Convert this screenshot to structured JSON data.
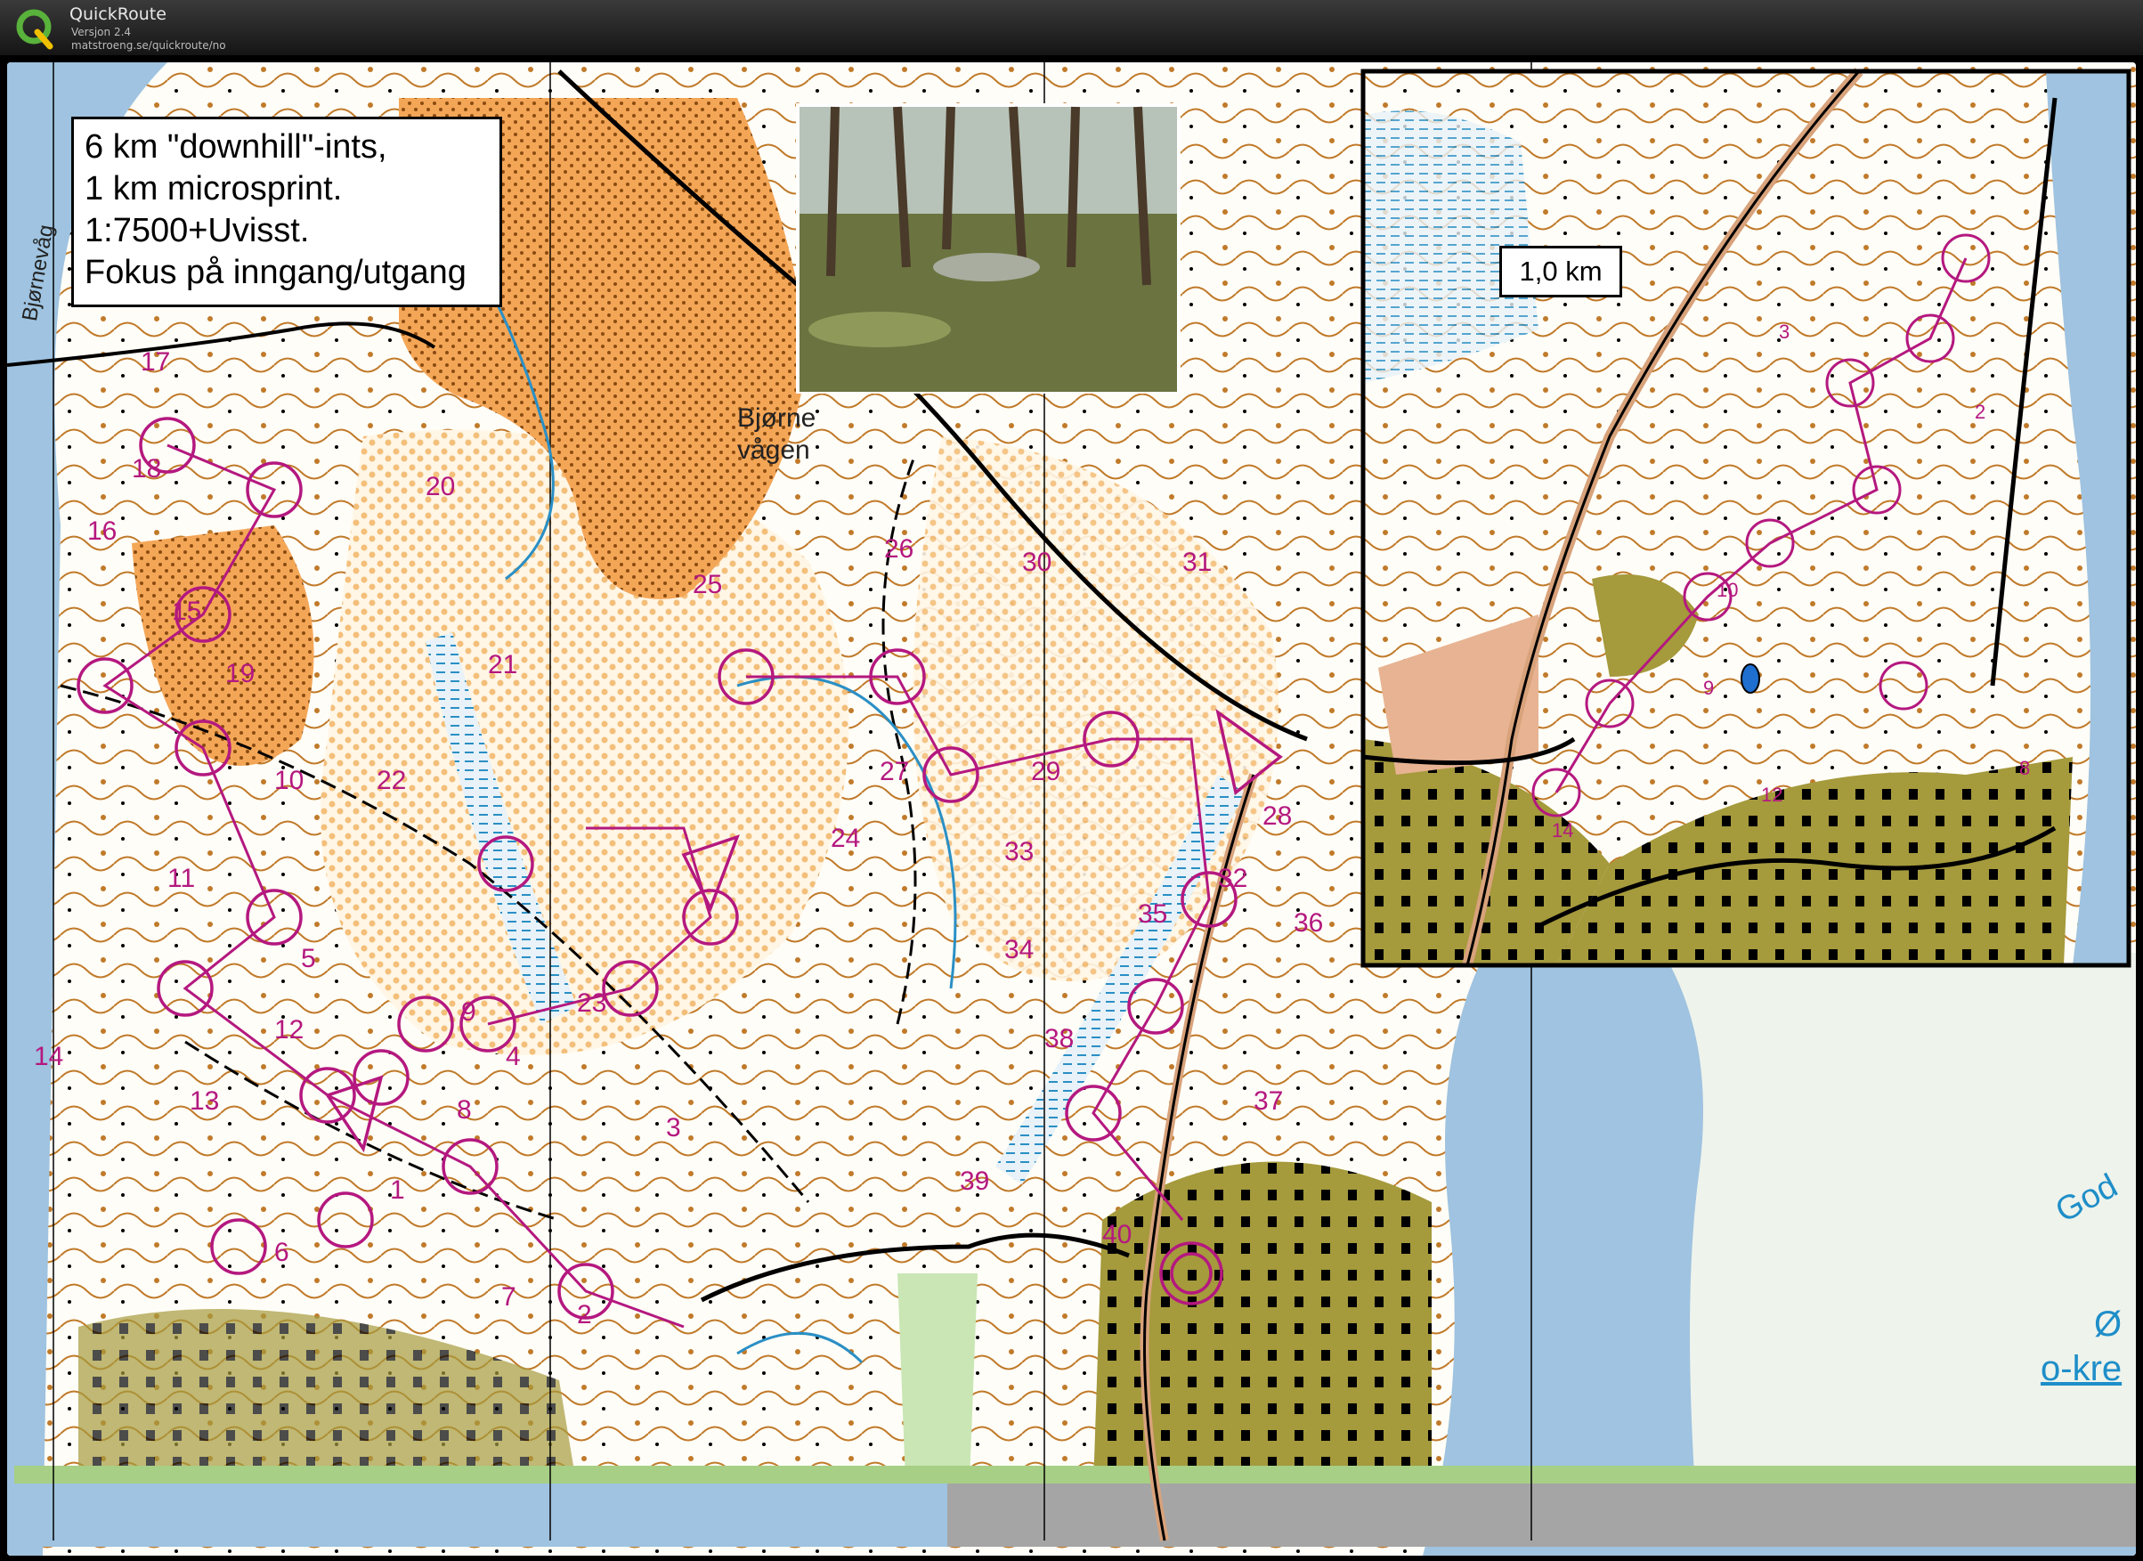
{
  "app": {
    "name": "QuickRoute",
    "version": "Versjon 2.4",
    "url": "matstroeng.se/quickroute/no"
  },
  "map": {
    "info_box": {
      "lines": [
        "6 km \"downhill\"-ints,",
        "1 km microsprint.",
        "1:7500+Uvisst.",
        "Fokus på inngang/utgang"
      ]
    },
    "inset_label": "1,0 km",
    "place_names": {
      "bjorne_line1": "Bjørne",
      "bjorne_line2": "vågen",
      "bjornevag": "Bjørnevåg"
    },
    "edge_text": {
      "god": "God",
      "o": "Ø",
      "okre": "o-kre"
    },
    "control_numbers_main": [
      "1",
      "2",
      "3",
      "4",
      "5",
      "6",
      "7",
      "8",
      "9",
      "10",
      "11",
      "12",
      "13",
      "14",
      "15",
      "16",
      "17",
      "18",
      "19",
      "20",
      "21",
      "22",
      "23",
      "24",
      "25",
      "26",
      "27",
      "28",
      "29",
      "30",
      "31",
      "32",
      "33",
      "34",
      "35",
      "36",
      "37",
      "38",
      "39",
      "40"
    ],
    "control_numbers_inset": [
      "2",
      "3",
      "8",
      "9",
      "10",
      "12",
      "14"
    ],
    "colors": {
      "water": "#9fc3e0",
      "open_land": "#f2a45a",
      "forest": "#ffffff",
      "green": "#c9e6b4",
      "settlement": "#8b8b2e",
      "course": "#b4187f",
      "contour": "#c07a2a"
    }
  }
}
